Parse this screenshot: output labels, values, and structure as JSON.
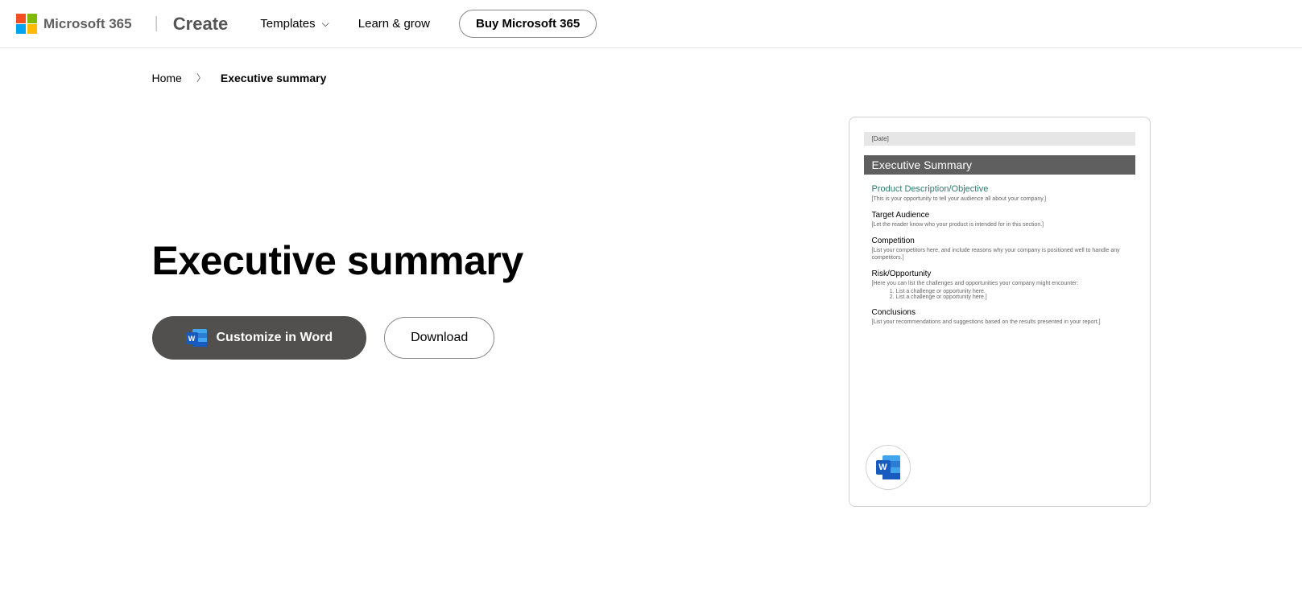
{
  "header": {
    "logo_text": "Microsoft 365",
    "create_label": "Create",
    "nav": {
      "templates": "Templates",
      "learn": "Learn & grow",
      "buy": "Buy Microsoft 365"
    }
  },
  "breadcrumb": {
    "home": "Home",
    "current": "Executive summary"
  },
  "page": {
    "title": "Executive summary",
    "customize_label": "Customize in Word",
    "download_label": "Download"
  },
  "preview": {
    "date": "[Date]",
    "title": "Executive Summary",
    "sections": {
      "product_h": "Product Description/Objective",
      "product_p": "[This is your opportunity to tell your audience all about your company.]",
      "audience_h": "Target Audience",
      "audience_p": "[Let the reader know who your product is intended for in this section.]",
      "competition_h": "Competition",
      "competition_p": "[List your competitors here, and include reasons why your company is positioned well to handle any competitors.]",
      "risk_h": "Risk/Opportunity",
      "risk_p": "[Here you can list the challenges and opportunities your company might encounter:",
      "risk_item1": "List a challenge or opportunity here.",
      "risk_item2": "List a challenge or opportunity here.]",
      "conclusions_h": "Conclusions",
      "conclusions_p": "[List your recommendations and suggestions based on the results presented in your report.]"
    }
  }
}
